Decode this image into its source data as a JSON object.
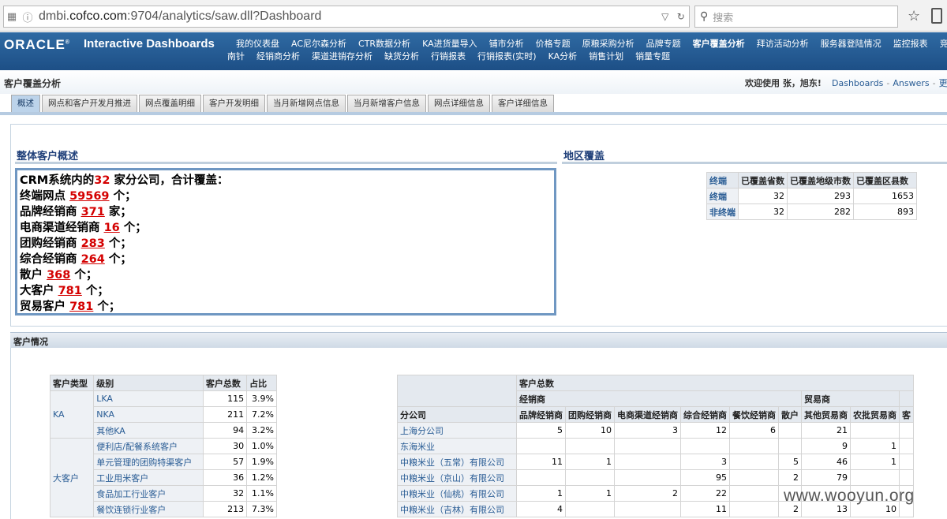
{
  "browser": {
    "url_prefix": "dmbi.",
    "url_host": "cofco.com",
    "url_rest": ":9704/analytics/saw.dll?Dashboard",
    "search_placeholder": "搜索"
  },
  "header": {
    "logo": "ORACLE",
    "app_title": "Interactive Dashboards",
    "nav_row1": [
      "我的仪表盘",
      "AC尼尔森分析",
      "CTR数据分析",
      "KA进货量导入",
      "铺市分析",
      "价格专题",
      "原粮采购分析",
      "品牌专题",
      "客户覆盖分析",
      "拜访活动分析",
      "服务器登陆情况",
      "监控报表",
      "竞争"
    ],
    "nav_row2": [
      "南针",
      "经销商分析",
      "渠道进销存分析",
      "缺货分析",
      "行销报表",
      "行销报表(实时)",
      "KA分析",
      "销售计划",
      "销量专题"
    ],
    "active_nav": "客户覆盖分析"
  },
  "page": {
    "title": "客户覆盖分析",
    "welcome": "欢迎使用 张，旭东!",
    "link_dashboards": "Dashboards",
    "link_answers": "Answers",
    "link_more": "更"
  },
  "tabs": [
    "概述",
    "网点和客户开发月推进",
    "网点覆盖明细",
    "客户开发明细",
    "当月新增网点信息",
    "当月新增客户信息",
    "网点详细信息",
    "客户详细信息"
  ],
  "overview": {
    "heading": "整体客户概述",
    "line0": {
      "pre": "CRM系统内的",
      "num": "32",
      "post": " 家分公司，合计覆盖："
    },
    "lines": [
      {
        "label": "终端网点 ",
        "num": "59569",
        "unit": " 个；"
      },
      {
        "label": "品牌经销商 ",
        "num": "371",
        "unit": " 家；"
      },
      {
        "label": "电商渠道经销商 ",
        "num": "16",
        "unit": " 个；"
      },
      {
        "label": "团购经销商 ",
        "num": "283",
        "unit": " 个；"
      },
      {
        "label": "综合经销商 ",
        "num": "264",
        "unit": " 个；"
      },
      {
        "label": "散户 ",
        "num": "368",
        "unit": " 个；"
      },
      {
        "label": "大客户 ",
        "num": "781",
        "unit": " 个；"
      },
      {
        "label": "贸易客户 ",
        "num": "781",
        "unit": " 个；"
      }
    ]
  },
  "region": {
    "heading": "地区覆盖",
    "headers": [
      "终端",
      "已覆盖省数",
      "已覆盖地级市数",
      "已覆盖区县数"
    ],
    "rows": [
      [
        "终端",
        "32",
        "293",
        "1653"
      ],
      [
        "非终端",
        "32",
        "282",
        "893"
      ]
    ]
  },
  "customer_section": {
    "heading": "客户情况",
    "left_table": {
      "headers": [
        "客户类型",
        "级别",
        "客户总数",
        "占比"
      ],
      "groups": [
        {
          "type": "KA",
          "rows": [
            [
              "LKA",
              "115",
              "3.9%"
            ],
            [
              "NKA",
              "211",
              "7.2%"
            ],
            [
              "其他KA",
              "94",
              "3.2%"
            ]
          ]
        },
        {
          "type": "大客户",
          "rows": [
            [
              "便利店/配餐系统客户",
              "30",
              "1.0%"
            ],
            [
              "单元管理的团购特渠客户",
              "57",
              "1.9%"
            ],
            [
              "工业用米客户",
              "36",
              "1.2%"
            ],
            [
              "食品加工行业客户",
              "32",
              "1.1%"
            ],
            [
              "餐饮连锁行业客户",
              "213",
              "7.3%"
            ]
          ]
        }
      ]
    },
    "right_table": {
      "top_header": "客户总数",
      "group_headers": [
        "经销商",
        "贸易商"
      ],
      "branch_header": "分公司",
      "columns": [
        "品牌经销商",
        "团购经销商",
        "电商渠道经销商",
        "综合经销商",
        "餐饮经销商",
        "散户",
        "其他贸易商",
        "农批贸易商",
        "客"
      ],
      "rows": [
        [
          "上海分公司",
          "5",
          "10",
          "3",
          "12",
          "6",
          "",
          "21",
          "",
          ""
        ],
        [
          "东海米业",
          "",
          "",
          "",
          "",
          "",
          "",
          "9",
          "1",
          ""
        ],
        [
          "中粮米业（五常）有限公司",
          "11",
          "1",
          "",
          "3",
          "",
          "5",
          "46",
          "1",
          ""
        ],
        [
          "中粮米业（京山）有限公司",
          "",
          "",
          "",
          "95",
          "",
          "2",
          "79",
          "",
          ""
        ],
        [
          "中粮米业（仙桃）有限公司",
          "1",
          "1",
          "2",
          "22",
          "",
          "",
          "",
          "",
          ""
        ],
        [
          "中粮米业（吉林）有限公司",
          "4",
          "",
          "",
          "11",
          "",
          "2",
          "13",
          "10",
          ""
        ]
      ]
    }
  },
  "watermark": "www.wooyun.org",
  "icons": [
    "grid-icon",
    "info-icon",
    "dropdown-arrow-icon",
    "refresh-icon",
    "search-icon",
    "star-icon",
    "clipboard-icon"
  ]
}
